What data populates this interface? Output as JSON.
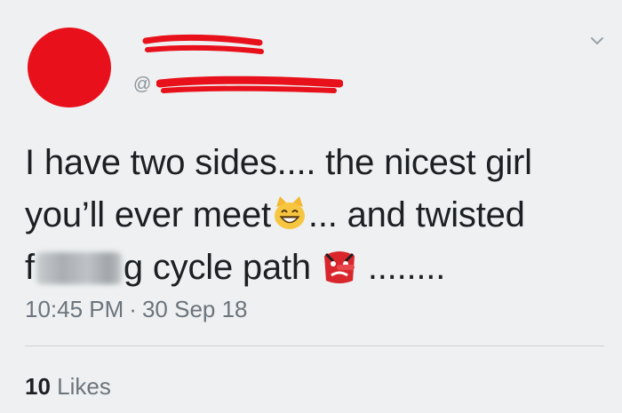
{
  "tweet": {
    "handle_prefix": "@",
    "text": {
      "line1": "I have two sides.... the nicest girl",
      "line2_before": "you’ll ever meet",
      "line2_after": "... and twisted",
      "line3_start": "f",
      "line3_after": "g cycle path",
      "line3_end": "........"
    },
    "emojis": [
      "grinning-cat-icon",
      "tengu-goblin-icon"
    ],
    "timestamp": {
      "time": "10:45 PM",
      "separator": "·",
      "date": "30 Sep 18"
    },
    "likes": {
      "count": "10",
      "label": "Likes"
    }
  },
  "colors": {
    "redaction": "#e8101a",
    "text": "#1c1f23",
    "muted": "#6c757d",
    "background": "#eef0f1"
  }
}
